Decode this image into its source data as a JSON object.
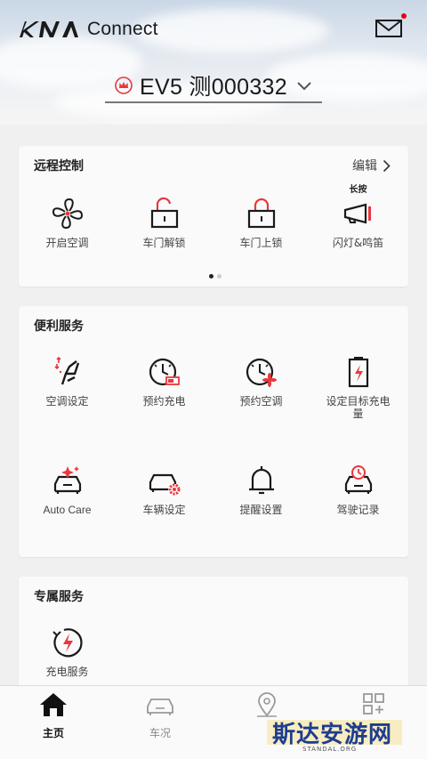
{
  "header": {
    "brand_logo_text": "KIA",
    "brand_suffix": "Connect",
    "vehicle_name": "EV5 测000332",
    "mail_has_unread": true
  },
  "remote_control": {
    "title": "远程控制",
    "edit_label": "编辑",
    "page_indicator": {
      "pages": 2,
      "current": 1
    },
    "items": [
      {
        "label": "开启空调",
        "icon": "fan-icon"
      },
      {
        "label": "车门解锁",
        "icon": "unlock-icon"
      },
      {
        "label": "车门上锁",
        "icon": "lock-icon"
      },
      {
        "label": "闪灯&鸣笛",
        "icon": "horn-icon",
        "hint": "长按"
      }
    ]
  },
  "convenience": {
    "title": "便利服务",
    "items": [
      {
        "label": "空调设定",
        "icon": "seat-climate-icon"
      },
      {
        "label": "预约充电",
        "icon": "charge-timer-icon"
      },
      {
        "label": "预约空调",
        "icon": "climate-timer-icon"
      },
      {
        "label": "设定目标充电量",
        "icon": "battery-target-icon"
      },
      {
        "label": "Auto Care",
        "icon": "auto-care-icon"
      },
      {
        "label": "车辆设定",
        "icon": "car-settings-icon"
      },
      {
        "label": "提醒设置",
        "icon": "bell-icon"
      },
      {
        "label": "驾驶记录",
        "icon": "drive-log-icon"
      }
    ]
  },
  "exclusive": {
    "title": "专属服务",
    "items": [
      {
        "label": "充电服务",
        "icon": "charging-service-icon"
      }
    ]
  },
  "tabbar": {
    "tabs": [
      {
        "label": "主页",
        "icon": "home-icon",
        "active": true
      },
      {
        "label": "车况",
        "icon": "car-icon",
        "active": false
      },
      {
        "label": "",
        "icon": "map-pin-icon",
        "active": false
      },
      {
        "label": "",
        "icon": "grid-add-icon",
        "active": false
      }
    ]
  },
  "watermark": {
    "text": "斯达安游网",
    "sub": "STANDAL.ORG"
  },
  "colors": {
    "accent": "#e8383d",
    "icon_dark": "#1a1a1a",
    "card_bg": "#fafafa",
    "page_bg": "#f0f0f0"
  }
}
